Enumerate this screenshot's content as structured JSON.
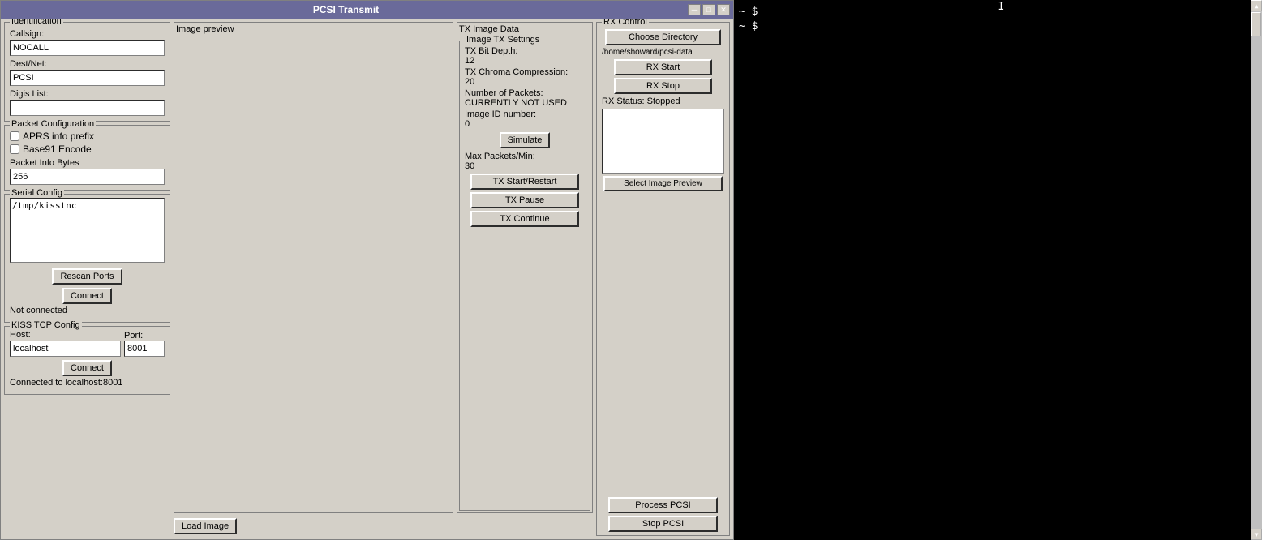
{
  "window": {
    "title": "PCSI Transmit",
    "min_btn": "─",
    "max_btn": "□",
    "close_btn": "✕"
  },
  "identification": {
    "group_title": "Identification",
    "callsign_label": "Callsign:",
    "callsign_value": "NOCALL",
    "dest_net_label": "Dest/Net:",
    "dest_net_value": "PCSI",
    "digis_list_label": "Digis List:",
    "digis_list_value": ""
  },
  "packet_config": {
    "group_title": "Packet Configuration",
    "aprs_prefix_label": "APRS info prefix",
    "aprs_prefix_checked": false,
    "base91_label": "Base91 Encode",
    "base91_checked": false,
    "packet_info_label": "Packet Info Bytes",
    "packet_info_value": "256"
  },
  "serial_config": {
    "group_title": "Serial Config",
    "serial_value": "/tmp/kisstnc",
    "rescan_btn": "Rescan Ports",
    "connect_btn": "Connect",
    "status": "Not connected"
  },
  "kiss_tcp": {
    "group_title": "KISS TCP Config",
    "host_label": "Host:",
    "host_value": "localhost",
    "port_label": "Port:",
    "port_value": "8001",
    "connect_btn": "Connect",
    "status": "Connected to localhost:8001"
  },
  "image_preview": {
    "label": "Image preview"
  },
  "load_image": {
    "btn": "Load Image"
  },
  "tx_image_data": {
    "label": "TX Image Data"
  },
  "tx_settings": {
    "group_title": "Image TX Settings",
    "tx_bit_depth_label": "TX Bit Depth:",
    "tx_bit_depth_value": "12",
    "tx_chroma_label": "TX Chroma Compression:",
    "tx_chroma_value": "20",
    "num_packets_label": "Number of Packets:",
    "num_packets_value": "CURRENTLY NOT USED",
    "image_id_label": "Image ID number:",
    "image_id_value": "0",
    "simulate_btn": "Simulate",
    "max_packets_label": "Max Packets/Min:",
    "max_packets_value": "30",
    "tx_start_btn": "TX Start/Restart",
    "tx_pause_btn": "TX Pause",
    "tx_continue_btn": "TX Continue"
  },
  "rx_control": {
    "group_title": "RX Control",
    "choose_dir_btn": "Choose Directory",
    "directory_path": "/home/showard/pcsi-data",
    "rx_start_btn": "RX Start",
    "rx_stop_btn": "RX Stop",
    "rx_status_text": "RX Status: Stopped",
    "select_preview_btn": "Select Image Preview",
    "process_pcsi_btn": "Process PCSI",
    "stop_pcsi_btn": "Stop PCSI"
  },
  "terminal": {
    "lines": [
      "~ $",
      "~ $"
    ]
  }
}
